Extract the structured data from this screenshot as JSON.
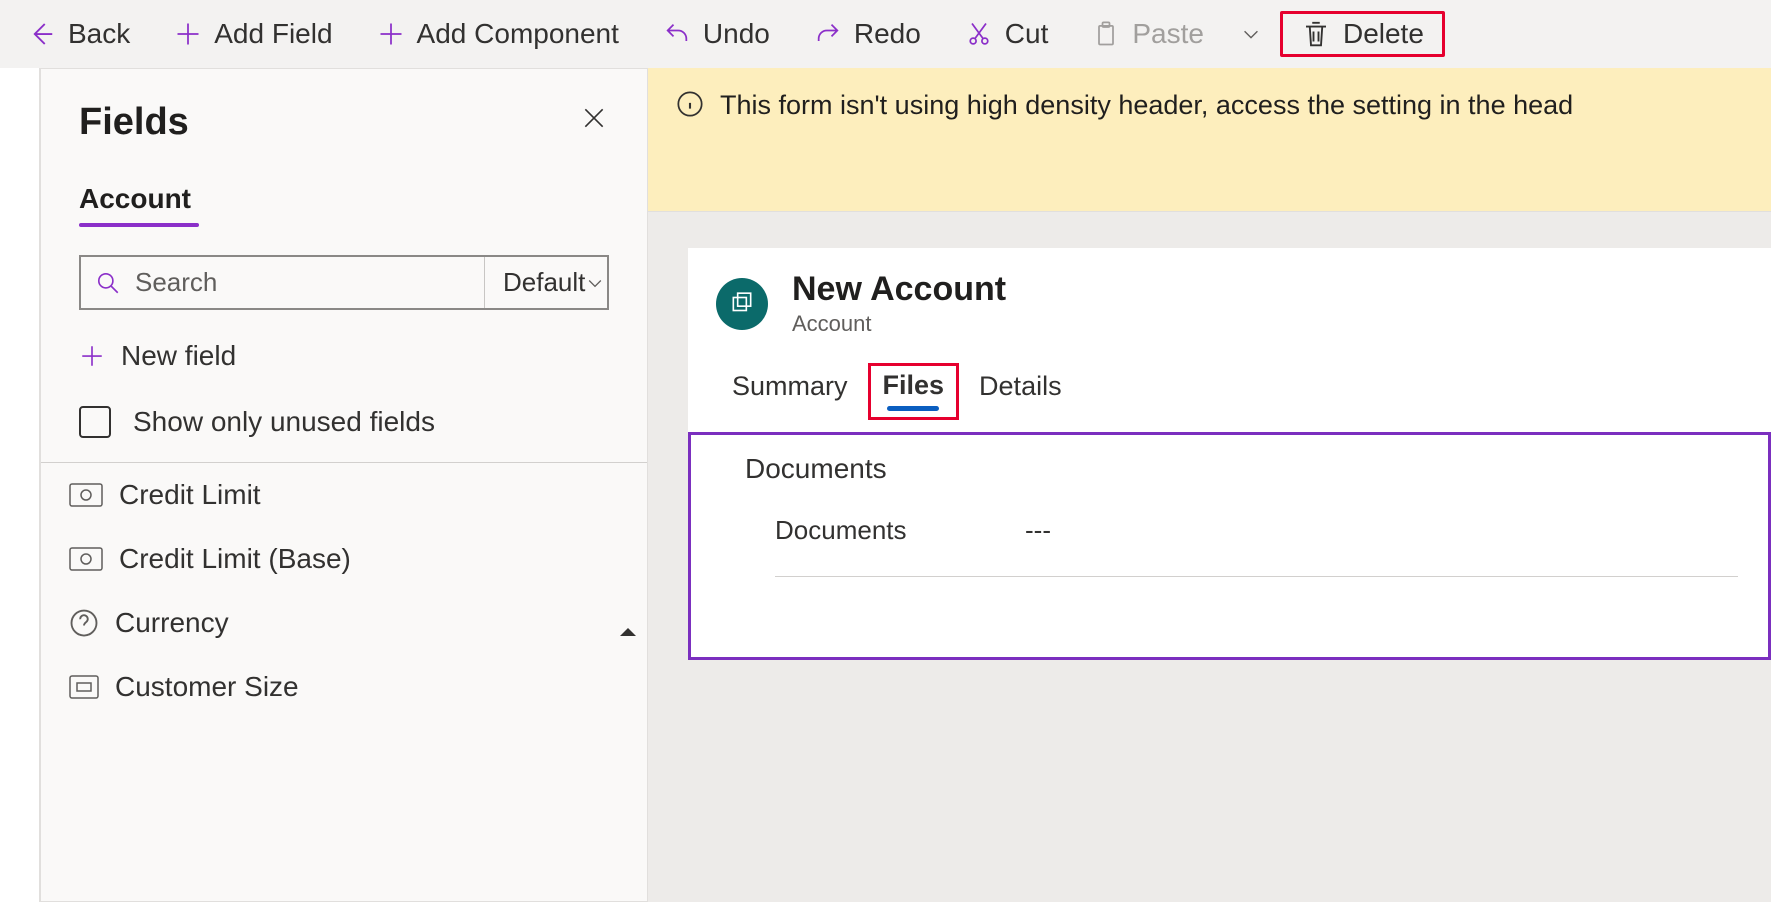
{
  "toolbar": {
    "back": "Back",
    "add_field": "Add Field",
    "add_component": "Add Component",
    "undo": "Undo",
    "redo": "Redo",
    "cut": "Cut",
    "paste": "Paste",
    "delete": "Delete"
  },
  "fields_panel": {
    "title": "Fields",
    "tab": "Account",
    "search_placeholder": "Search",
    "filter_default": "Default",
    "new_field": "New field",
    "show_unused": "Show only unused fields",
    "items": [
      {
        "label": "Credit Limit",
        "icon": "money"
      },
      {
        "label": "Credit Limit (Base)",
        "icon": "money"
      },
      {
        "label": "Currency",
        "icon": "help"
      },
      {
        "label": "Customer Size",
        "icon": "box"
      }
    ]
  },
  "banner": {
    "text": "This form isn't using high density header, access the setting in the head"
  },
  "form": {
    "title": "New Account",
    "subtitle": "Account",
    "tabs": [
      "Summary",
      "Files",
      "Details"
    ],
    "active_tab": "Files",
    "section_title": "Documents",
    "doc_label": "Documents",
    "doc_value": "---"
  }
}
